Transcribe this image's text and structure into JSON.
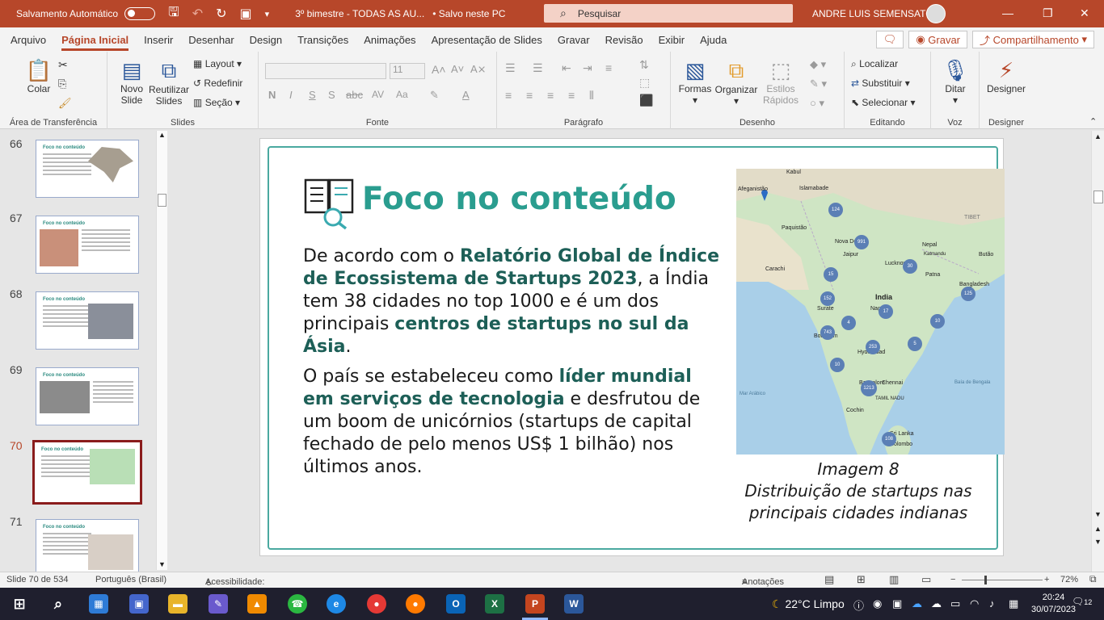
{
  "titlebar": {
    "autosave_label": "Salvamento Automático",
    "doc_title": "3º bimestre - TODAS AS AU...",
    "saved_status": "• Salvo neste PC",
    "search_placeholder": "Pesquisar",
    "user_name": "ANDRE LUIS SEMENSATO"
  },
  "menu": {
    "items": [
      "Arquivo",
      "Página Inicial",
      "Inserir",
      "Desenhar",
      "Design",
      "Transições",
      "Animações",
      "Apresentação de Slides",
      "Gravar",
      "Revisão",
      "Exibir",
      "Ajuda"
    ],
    "active": "Página Inicial",
    "record_button": "Gravar",
    "share_button": "Compartilhamento"
  },
  "ribbon": {
    "clipboard": {
      "label": "Área de Transferência",
      "paste": "Colar"
    },
    "slides": {
      "label": "Slides",
      "new_slide_1": "Novo",
      "new_slide_2": "Slide",
      "reuse_1": "Reutilizar",
      "reuse_2": "Slides",
      "layout": "Layout",
      "reset": "Redefinir",
      "section": "Seção"
    },
    "font": {
      "label": "Fonte",
      "size": "11"
    },
    "paragraph": {
      "label": "Parágrafo"
    },
    "drawing": {
      "label": "Desenho",
      "shapes": "Formas",
      "arrange": "Organizar",
      "quick_styles_1": "Estilos",
      "quick_styles_2": "Rápidos"
    },
    "editing": {
      "label": "Editando",
      "find": "Localizar",
      "replace": "Substituir",
      "select": "Selecionar"
    },
    "voice": {
      "label": "Voz",
      "dictate": "Ditar"
    },
    "designer": {
      "label": "Designer",
      "button": "Designer"
    }
  },
  "thumbnails": [
    {
      "num": "66",
      "title": "Foco no conteúdo",
      "active": false
    },
    {
      "num": "67",
      "title": "Foco no conteúdo",
      "active": false
    },
    {
      "num": "68",
      "title": "Foco no conteúdo",
      "active": false
    },
    {
      "num": "69",
      "title": "Foco no conteúdo",
      "active": false
    },
    {
      "num": "70",
      "title": "Foco no conteúdo",
      "active": true
    },
    {
      "num": "71",
      "title": "Foco no conteúdo",
      "active": false
    }
  ],
  "slide": {
    "title": "Foco no conteúdo",
    "p1_a": "De acordo com o ",
    "p1_b": "Relatório Global de Índice de Ecossistema de Startups 2023",
    "p1_c": ", a Índia tem 38 cidades no top 1000 e é um dos principais ",
    "p1_d": "centros de startups no sul da Ásia",
    "p1_e": ".",
    "p2_a": "O país se estabeleceu como ",
    "p2_b": "líder mundial em serviços de tecnologia",
    "p2_c": " e desfrutou de um boom de unicórnios (startups de capital fechado de pelo menos US$ 1 bilhão) nos últimos anos.",
    "caption_1": "Imagem 8",
    "caption_2": "Distribuição de startups nas principais cidades indianas",
    "map_labels": [
      "Kabul",
      "Islamabade",
      "Afeganistão",
      "Paquistão",
      "Nova Délhi",
      "Jaipur",
      "Nepal",
      "Butão",
      "Lucknow",
      "Patna",
      "Bangladesh",
      "Carachi",
      "India",
      "Surate",
      "Nagpur",
      "Mumbai",
      "Hyderabad",
      "Bangalore",
      "Chennai",
      "Cochin",
      "Sri Lanka",
      "Colombo",
      "Mar Arábico",
      "Baía de Bengala",
      "TAMIL NADU",
      "TIBET",
      "Katmandu",
      "Bombaim"
    ],
    "map_badges": [
      "124",
      "991",
      "15",
      "30",
      "152",
      "17",
      "743",
      "4",
      "253",
      "10",
      "5",
      "10",
      "1213",
      "125",
      "108"
    ]
  },
  "status": {
    "slide_info": "Slide 70 de 534",
    "language": "Português (Brasil)",
    "accessibility": "Acessibilidade: investigar",
    "notes": "Anotações",
    "zoom": "72%"
  },
  "taskbar": {
    "weather": "22°C  Limpo",
    "time": "20:24",
    "date": "30/07/2023",
    "notif_count": "12"
  },
  "colors": {
    "accent": "#b7472a",
    "teal": "#2a9d8f",
    "dark_teal": "#1d5f57"
  }
}
